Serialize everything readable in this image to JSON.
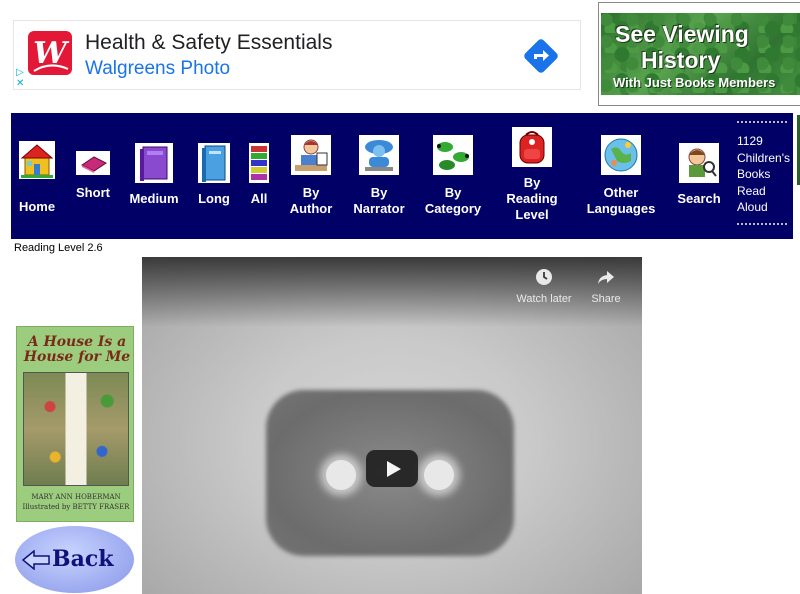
{
  "ad": {
    "title": "Health & Safety Essentials",
    "subtitle": "Walgreens Photo",
    "brand_color": "#e31837",
    "link_color": "#1a73e8",
    "arrow_color": "#1a73e8",
    "icons": [
      "walgreens-logo",
      "adchoices-icon",
      "directions-arrow-icon"
    ]
  },
  "promo": {
    "line1": "See Viewing",
    "line2": "History",
    "line3": "With Just Books Members"
  },
  "nav": {
    "background": "#000066",
    "items": [
      {
        "label": "Home",
        "icon": "house-icon"
      },
      {
        "label": "Short",
        "icon": "short-book-icon"
      },
      {
        "label": "Medium",
        "icon": "medium-book-icon"
      },
      {
        "label": "Long",
        "icon": "long-book-icon"
      },
      {
        "label": "All",
        "icon": "book-stack-icon"
      },
      {
        "label_1": "By",
        "label_2": "Author",
        "icon": "author-icon"
      },
      {
        "label_1": "By",
        "label_2": "Narrator",
        "icon": "narrator-icon"
      },
      {
        "label_1": "By",
        "label_2": "Category",
        "icon": "category-icon"
      },
      {
        "label_1": "By",
        "label_2": "Reading",
        "label_3": "Level",
        "icon": "backpack-icon"
      },
      {
        "label_1": "Other",
        "label_2": "Languages",
        "icon": "globe-icon"
      },
      {
        "label": "Search",
        "icon": "search-kid-icon"
      }
    ],
    "count": {
      "number": "1129",
      "line2": "Children's",
      "line3": "Books",
      "line4": "Read",
      "line5": "Aloud"
    }
  },
  "reading_level": "Reading Level 2.6",
  "video": {
    "watch_later": "Watch later",
    "share": "Share"
  },
  "book": {
    "title": "A House Is a House for Me",
    "author": "MARY ANN HOBERMAN",
    "illustrator": "Illustrated by BETTY FRASER"
  },
  "back_label": "Back"
}
